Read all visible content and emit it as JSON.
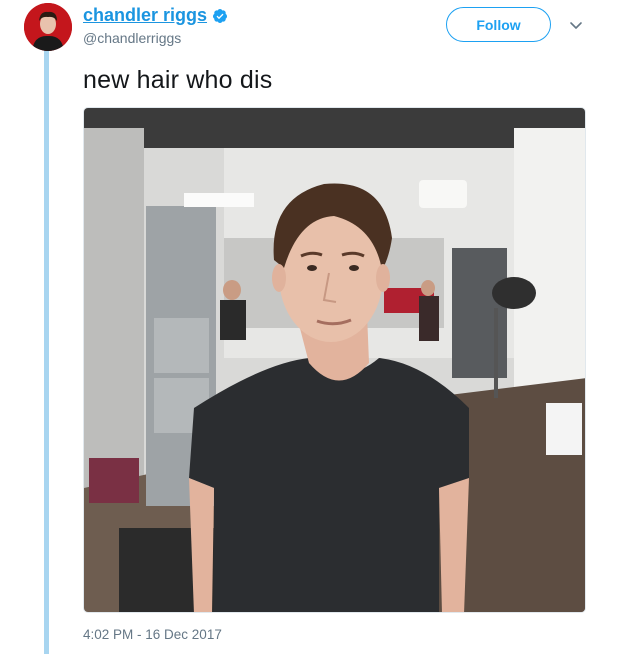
{
  "tweet": {
    "display_name": "chandler riggs",
    "handle": "@chandlerriggs",
    "verified": true,
    "text": "new hair who dis",
    "timestamp": "4:02 PM - 16 Dec 2017",
    "follow_label": "Follow"
  },
  "colors": {
    "accent": "#1da1f2",
    "name": "#1b95e0",
    "thread_line": "#a8d5f0",
    "secondary_text": "#657786"
  },
  "icons": {
    "verified": "verified-badge-icon",
    "more": "chevron-down-icon"
  }
}
